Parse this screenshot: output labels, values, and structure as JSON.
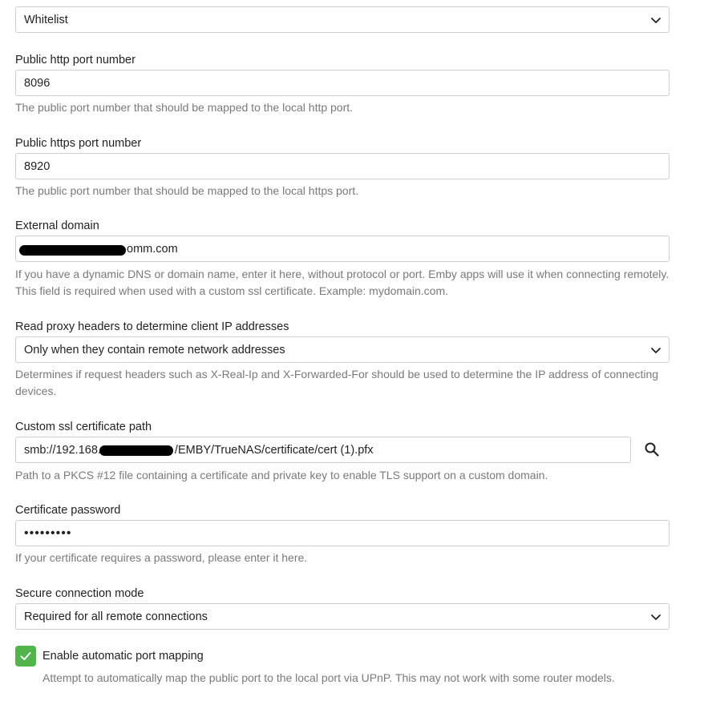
{
  "fields": {
    "access_mode": {
      "value": "Whitelist"
    },
    "http_port": {
      "label": "Public http port number",
      "value": "8096",
      "help": "The public port number that should be mapped to the local http port."
    },
    "https_port": {
      "label": "Public https port number",
      "value": "8920",
      "help": "The public port number that should be mapped to the local https port."
    },
    "external_domain": {
      "label": "External domain",
      "value_visible": "omm.com",
      "help": "If you have a dynamic DNS or domain name, enter it here, without protocol or port. Emby apps will use it when connecting remotely. This field is required when used with a custom ssl certificate. Example: mydomain.com."
    },
    "proxy_headers": {
      "label": "Read proxy headers to determine client IP addresses",
      "value": "Only when they contain remote network addresses",
      "help": "Determines if request headers such as X-Real-Ip and X-Forwarded-For should be used to determine the IP address of connecting devices."
    },
    "ssl_cert_path": {
      "label": "Custom ssl certificate path",
      "value_prefix": "smb://192.168.",
      "value_suffix": "/EMBY/TrueNAS/certificate/cert (1).pfx",
      "help": "Path to a PKCS #12 file containing a certificate and private key to enable TLS support on a custom domain."
    },
    "cert_password": {
      "label": "Certificate password",
      "value_masked": "•••••••••",
      "help": "If your certificate requires a password, please enter it here."
    },
    "secure_mode": {
      "label": "Secure connection mode",
      "value": "Required for all remote connections"
    },
    "auto_port_mapping": {
      "label": "Enable automatic port mapping",
      "checked": true,
      "help": "Attempt to automatically map the public port to the local port via UPnP. This may not work with some router models."
    }
  },
  "icons": {
    "dropdown": "chevron-down-icon",
    "browse": "search-icon",
    "check": "checkmark-icon"
  },
  "colors": {
    "accent": "#52b54b",
    "border": "#cfcfcf",
    "help_text": "#7a7a7a"
  }
}
